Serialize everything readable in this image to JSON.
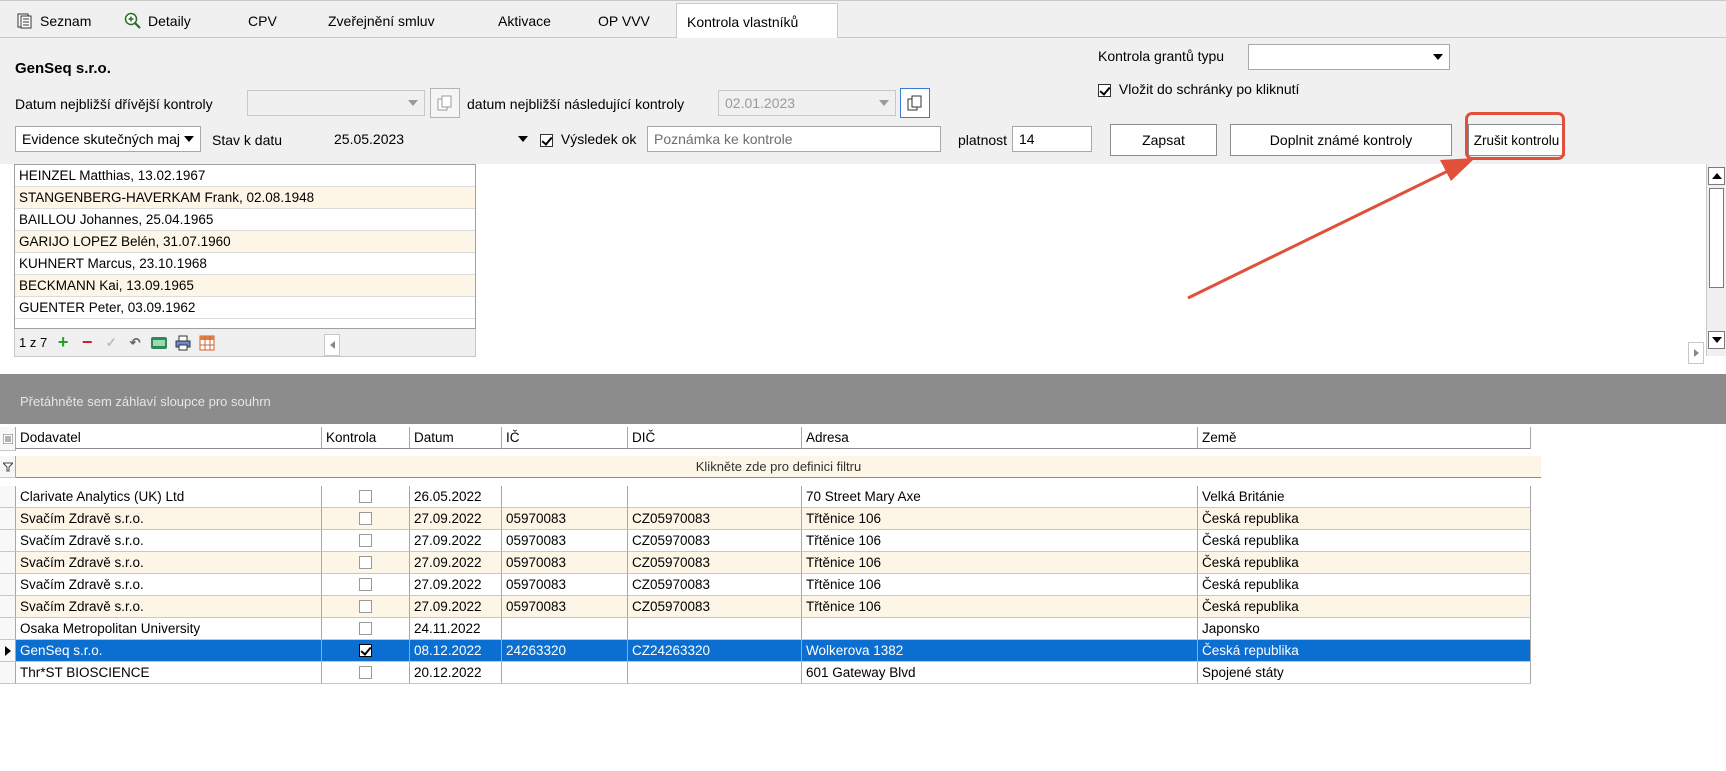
{
  "tabs": [
    {
      "label": "Seznam",
      "icon": "list-icon"
    },
    {
      "label": "Detaily",
      "icon": "magnifier-icon"
    },
    {
      "label": "CPV"
    },
    {
      "label": "Zveřejnění smluv"
    },
    {
      "label": "Aktivace"
    },
    {
      "label": "OP VVV"
    },
    {
      "label": "Kontrola vlastníků",
      "active": true
    }
  ],
  "form": {
    "company_name": "GenSeq s.r.o.",
    "prev_check_label": "Datum nejbližší dřívější kontroly",
    "prev_check_value": "",
    "next_check_label": "datum nejbližší následující kontroly",
    "next_check_value": "02.01.2023",
    "grant_type_label": "Kontrola grantů typu",
    "grant_type_value": "",
    "clipboard_label": "Vložit do schránky po kliknutí",
    "evidence_value": "Evidence skutečných maj",
    "state_date_label": "Stav k datu",
    "state_date_value": "25.05.2023",
    "result_ok_label": "Výsledek ok",
    "note_placeholder": "Poznámka ke kontrole",
    "validity_label": "platnost",
    "validity_value": "14",
    "write_button": "Zapsat",
    "fill_known_button": "Doplnit známé kontroly",
    "cancel_button": "Zrušit kontrolu"
  },
  "owners": [
    "HEINZEL Matthias, 13.02.1967",
    "STANGENBERG-HAVERKAM Frank, 02.08.1948",
    "BAILLOU Johannes, 25.04.1965",
    "GARIJO LOPEZ Belén, 31.07.1960",
    "KUHNERT Marcus, 23.10.1968",
    "BECKMANN Kai, 13.09.1965",
    "GUENTER Peter, 03.09.1962"
  ],
  "list_toolbar": {
    "record_counter": "1 z 7"
  },
  "grid": {
    "group_hint": "Přetáhněte sem záhlaví sloupce pro souhrn",
    "filter_hint": "Klikněte zde pro definici filtru",
    "columns": [
      "Dodavatel",
      "Kontrola",
      "Datum",
      "IČ",
      "DIČ",
      "Adresa",
      "Země"
    ],
    "rows": [
      {
        "dodavatel": "Clarivate Analytics (UK) Ltd",
        "kontrola": false,
        "datum": "26.05.2022",
        "ic": "",
        "dic": "",
        "adresa": "70 Street Mary Axe",
        "zeme": "Velká Británie"
      },
      {
        "dodavatel": "Svačím Zdravě s.r.o.",
        "kontrola": false,
        "datum": "27.09.2022",
        "ic": "05970083",
        "dic": "CZ05970083",
        "adresa": "Třtěnice 106",
        "zeme": "Česká republika"
      },
      {
        "dodavatel": "Svačím Zdravě s.r.o.",
        "kontrola": false,
        "datum": "27.09.2022",
        "ic": "05970083",
        "dic": "CZ05970083",
        "adresa": "Třtěnice 106",
        "zeme": "Česká republika"
      },
      {
        "dodavatel": "Svačím Zdravě s.r.o.",
        "kontrola": false,
        "datum": "27.09.2022",
        "ic": "05970083",
        "dic": "CZ05970083",
        "adresa": "Třtěnice 106",
        "zeme": "Česká republika"
      },
      {
        "dodavatel": "Svačím Zdravě s.r.o.",
        "kontrola": false,
        "datum": "27.09.2022",
        "ic": "05970083",
        "dic": "CZ05970083",
        "adresa": "Třtěnice 106",
        "zeme": "Česká republika"
      },
      {
        "dodavatel": "Svačím Zdravě s.r.o.",
        "kontrola": false,
        "datum": "27.09.2022",
        "ic": "05970083",
        "dic": "CZ05970083",
        "adresa": "Třtěnice 106",
        "zeme": "Česká republika"
      },
      {
        "dodavatel": "Osaka Metropolitan University",
        "kontrola": false,
        "datum": "24.11.2022",
        "ic": "",
        "dic": "",
        "adresa": "",
        "zeme": "Japonsko"
      },
      {
        "dodavatel": "GenSeq s.r.o.",
        "kontrola": true,
        "datum": "08.12.2022",
        "ic": "24263320",
        "dic": "CZ24263320",
        "adresa": "Wolkerova 1382",
        "zeme": "Česká republika",
        "selected": true
      },
      {
        "dodavatel": "Thr*ST BIOSCIENCE",
        "kontrola": false,
        "datum": "20.12.2022",
        "ic": "",
        "dic": "",
        "adresa": "601 Gateway Blvd",
        "zeme": "Spojené státy"
      }
    ]
  },
  "colors": {
    "selection": "#0a6fd0",
    "alt_row": "#fdf5e6",
    "annotation": "#e0503a"
  }
}
